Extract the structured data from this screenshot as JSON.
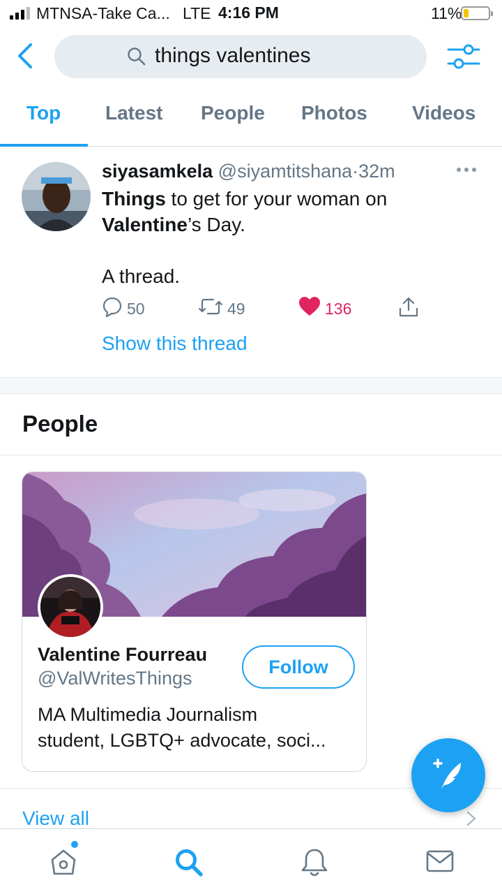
{
  "status_bar": {
    "carrier": "MTNSA-Take Ca...",
    "network": "LTE",
    "time": "4:16 PM",
    "battery": "11%"
  },
  "search": {
    "query": "things valentines",
    "icons": [
      "back-chevron-icon",
      "search-icon",
      "filter-icon"
    ]
  },
  "tabs": [
    {
      "label": "Top",
      "active": true
    },
    {
      "label": "Latest",
      "active": false
    },
    {
      "label": "People",
      "active": false
    },
    {
      "label": "Photos",
      "active": false
    },
    {
      "label": "Videos",
      "active": false
    }
  ],
  "tweet": {
    "name": "siyasamkela",
    "handle": "@siyamtitshana",
    "separator": "·",
    "time": "32m",
    "text_line1_bold": "Things",
    "text_line1_rest": " to get for your woman on",
    "text_line2_bold": "Valentine",
    "text_line2_rest": "’s Day.",
    "text_line3": "A thread.",
    "replies": "50",
    "retweets": "49",
    "likes": "136",
    "show_thread": "Show this thread"
  },
  "people": {
    "section_title": "People",
    "card": {
      "name": "Valentine Fourreau",
      "handle": "@ValWritesThings",
      "follow_label": "Follow",
      "bio_line1": "MA Multimedia Journalism",
      "bio_line2": "student, LGBTQ+ advocate, soci..."
    },
    "view_all": "View all"
  },
  "colors": {
    "accent": "#1da1f2",
    "like": "#e0245e",
    "secondary_text": "#657786",
    "search_bg": "#e6ecf0"
  },
  "bottom_nav": [
    "home-icon",
    "search-icon",
    "notifications-bell-icon",
    "messages-mail-icon"
  ]
}
